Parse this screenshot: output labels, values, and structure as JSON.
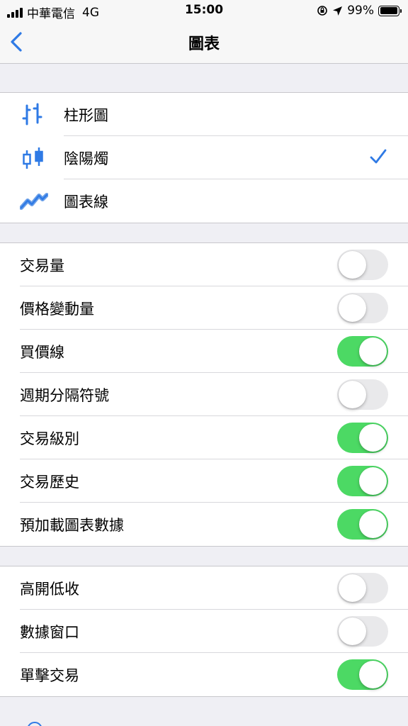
{
  "status_bar": {
    "carrier": "中華電信",
    "network": "4G",
    "time": "15:00",
    "battery_percent": "99%",
    "battery_level": 0.99
  },
  "nav": {
    "title": "圖表",
    "back_icon": "chevron-left-icon"
  },
  "chart_types": [
    {
      "label": "柱形圖",
      "icon": "bar-chart-icon",
      "selected": false
    },
    {
      "label": "陰陽燭",
      "icon": "candlestick-icon",
      "selected": true
    },
    {
      "label": "圖表線",
      "icon": "line-chart-icon",
      "selected": false
    }
  ],
  "settings_group_1": [
    {
      "label": "交易量",
      "on": false
    },
    {
      "label": "價格變動量",
      "on": false
    },
    {
      "label": "買價線",
      "on": true
    },
    {
      "label": "週期分隔符號",
      "on": false
    },
    {
      "label": "交易級別",
      "on": true
    },
    {
      "label": "交易歷史",
      "on": true
    },
    {
      "label": "預加載圖表數據",
      "on": true
    }
  ],
  "settings_group_2": [
    {
      "label": "高開低收",
      "on": false
    },
    {
      "label": "數據窗口",
      "on": false
    },
    {
      "label": "單擊交易",
      "on": true
    }
  ],
  "colors": {
    "accent": "#2f7ae5",
    "toggle_on": "#4cd964",
    "toggle_off": "#e9e9eb",
    "background": "#efeff4"
  }
}
